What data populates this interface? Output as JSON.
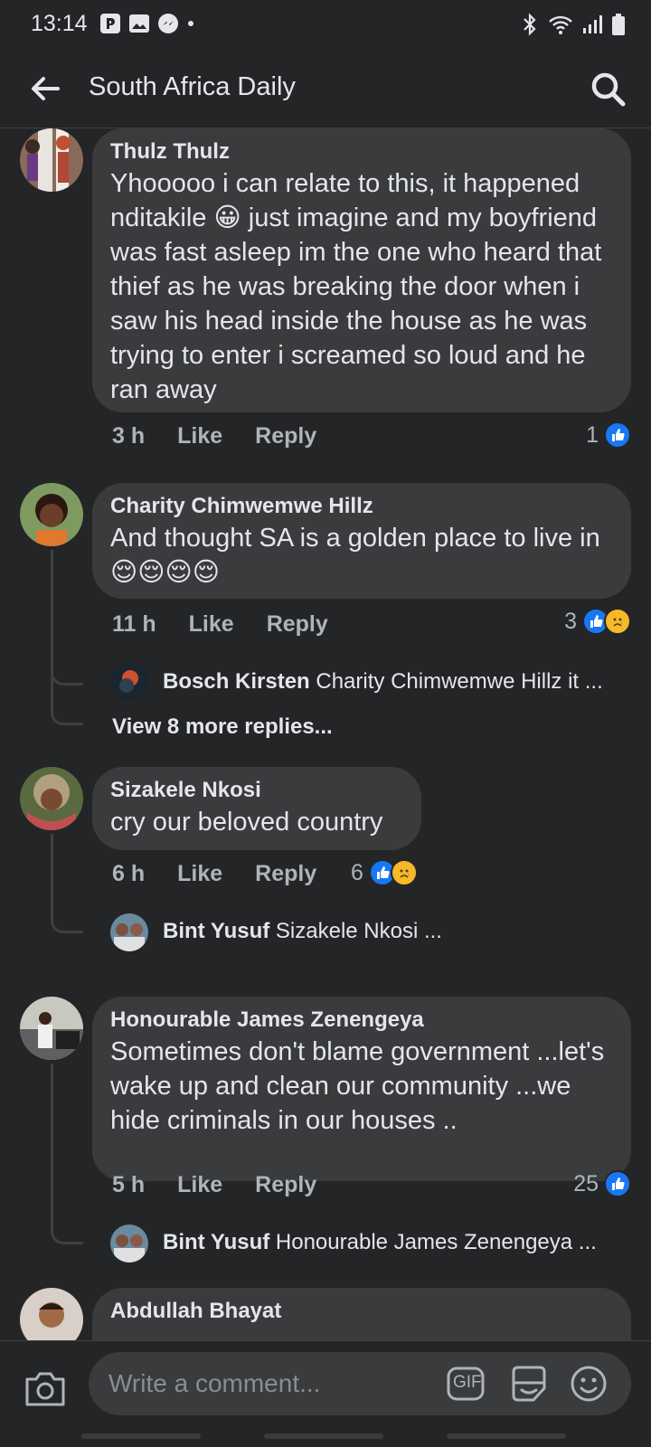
{
  "status": {
    "time": "13:14"
  },
  "header": {
    "title": "South Africa Daily"
  },
  "comments": [
    {
      "author": "Thulz Thulz",
      "text_a": "Yhooooo i can relate to this, it happened nditakile ",
      "text_b": " just imagine and my boyfriend was fast asleep im the one who heard that thief as he was breaking the door when i saw his head inside the house as he was trying to enter i screamed so loud and he ran away",
      "time": "3 h",
      "like": "Like",
      "reply": "Reply",
      "reaction_count": "1"
    },
    {
      "author": "Charity Chimwemwe Hillz",
      "text": "And thought SA is a golden place to live in😌😌😌😌",
      "time": "11 h",
      "like": "Like",
      "reply": "Reply",
      "reaction_count": "3",
      "reply_preview": {
        "name": "Bosch Kirsten",
        "text": "Charity Chimwemwe Hillz it ..."
      },
      "more_replies": "View 8 more replies..."
    },
    {
      "author": "Sizakele Nkosi",
      "text": "cry our beloved country",
      "time": "6 h",
      "like": "Like",
      "reply": "Reply",
      "reaction_count": "6",
      "reply_preview": {
        "name": "Bint Yusuf",
        "text": "Sizakele Nkosi ..."
      }
    },
    {
      "author": "Honourable James Zenengeya",
      "text": "Sometimes don't blame government ...let's wake up and clean our community ...we hide criminals in our houses ..",
      "time": "5 h",
      "like": "Like",
      "reply": "Reply",
      "reaction_count": "25",
      "reply_preview": {
        "name": "Bint Yusuf",
        "text": "Honourable James Zenengeya ..."
      }
    },
    {
      "author": "Abdullah Bhayat"
    }
  ],
  "composer": {
    "placeholder": "Write a comment...",
    "gif_label": "GIF"
  },
  "colors": {
    "background": "#242526",
    "bubble": "#3a3b3c",
    "like_blue": "#1877f2",
    "sad_yellow": "#f7b928",
    "muted": "#b0b3b8"
  },
  "icons": [
    "back-arrow-icon",
    "search-icon",
    "camera-icon",
    "gif-icon",
    "sticker-icon",
    "emoji-icon",
    "like-reaction-icon",
    "sad-reaction-icon"
  ]
}
